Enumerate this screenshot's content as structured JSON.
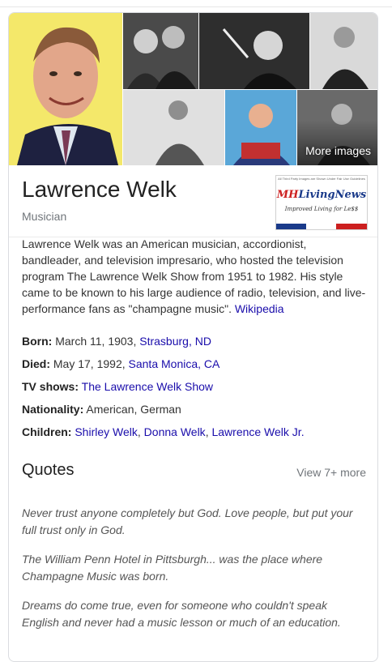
{
  "gallery": {
    "more_images_label": "More images"
  },
  "entity": {
    "name": "Lawrence Welk",
    "subtitle": "Musician"
  },
  "logo": {
    "small_text": "All Third Party Images are Shown Under Fair Use Guidelines",
    "brand_prefix": "MH",
    "brand_rest": "LivingNews",
    "tagline": "Improved Living for Le$$"
  },
  "description": {
    "text": "Lawrence Welk was an American musician, accordionist, bandleader, and television impresario, who hosted the television program The Lawrence Welk Show from 1951 to 1982. His style came to be known to his large audience of radio, television, and live-performance fans as \"champagne music\". ",
    "source_link": "Wikipedia"
  },
  "facts": {
    "born": {
      "label": "Born:",
      "text": " March 11, 1903, ",
      "link": "Strasburg, ND"
    },
    "died": {
      "label": "Died:",
      "text": " May 17, 1992, ",
      "link": "Santa Monica, CA"
    },
    "tv_shows": {
      "label": "TV shows:",
      "link": "The Lawrence Welk Show"
    },
    "nationality": {
      "label": "Nationality:",
      "text": " American, German"
    },
    "children": {
      "label": "Children:",
      "links": [
        "Shirley Welk",
        "Donna Welk",
        "Lawrence Welk Jr."
      ],
      "sep": ", "
    }
  },
  "quotes": {
    "title": "Quotes",
    "view_more": "View 7+ more",
    "items": [
      "Never trust anyone completely but God. Love people, but put your full trust only in God.",
      "The William Penn Hotel in Pittsburgh... was the place where Champagne Music was born.",
      "Dreams do come true, even for someone who couldn't speak English and never had a music lesson or much of an education."
    ]
  },
  "colors": {
    "link": "#1a0dab",
    "muted": "#70757a",
    "portrait_bg": "#f4e86a"
  }
}
